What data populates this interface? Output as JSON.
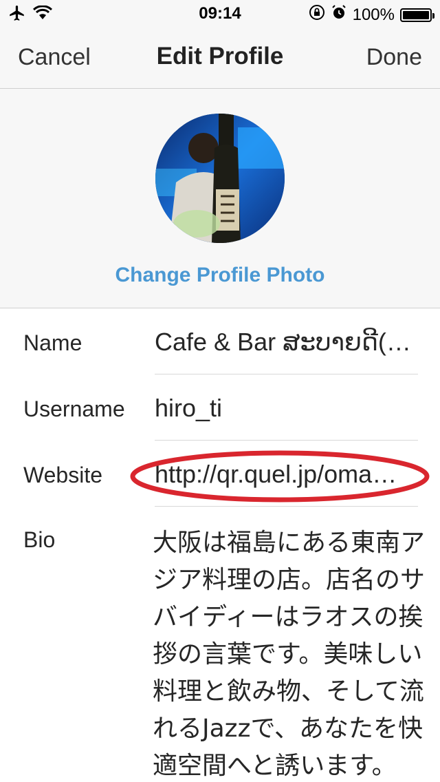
{
  "status_bar": {
    "time": "09:14",
    "battery_text": "100%",
    "icons": [
      "airplane-icon",
      "wifi-icon",
      "orientation-lock-icon",
      "alarm-icon",
      "battery-icon"
    ]
  },
  "nav": {
    "cancel_label": "Cancel",
    "title": "Edit Profile",
    "done_label": "Done"
  },
  "profile": {
    "change_photo_label": "Change Profile Photo"
  },
  "form": {
    "name": {
      "label": "Name",
      "value": "Cafe & Bar ສະບາຍດີ(…"
    },
    "username": {
      "label": "Username",
      "value": "hiro_ti"
    },
    "website": {
      "label": "Website",
      "value": "http://qr.quel.jp/oma…"
    },
    "bio": {
      "label": "Bio",
      "value": "大阪は福島にある東南アジア料理の店。店名のサバイディーはラオスの挨拶の言葉です。美味しい料理と飲み物、そして流れるJazzで、あなたを快適空間へと誘います。"
    }
  },
  "colors": {
    "accent": "#4a98d3",
    "annotation": "#d9262e",
    "bar_background": "#f7f7f7"
  }
}
